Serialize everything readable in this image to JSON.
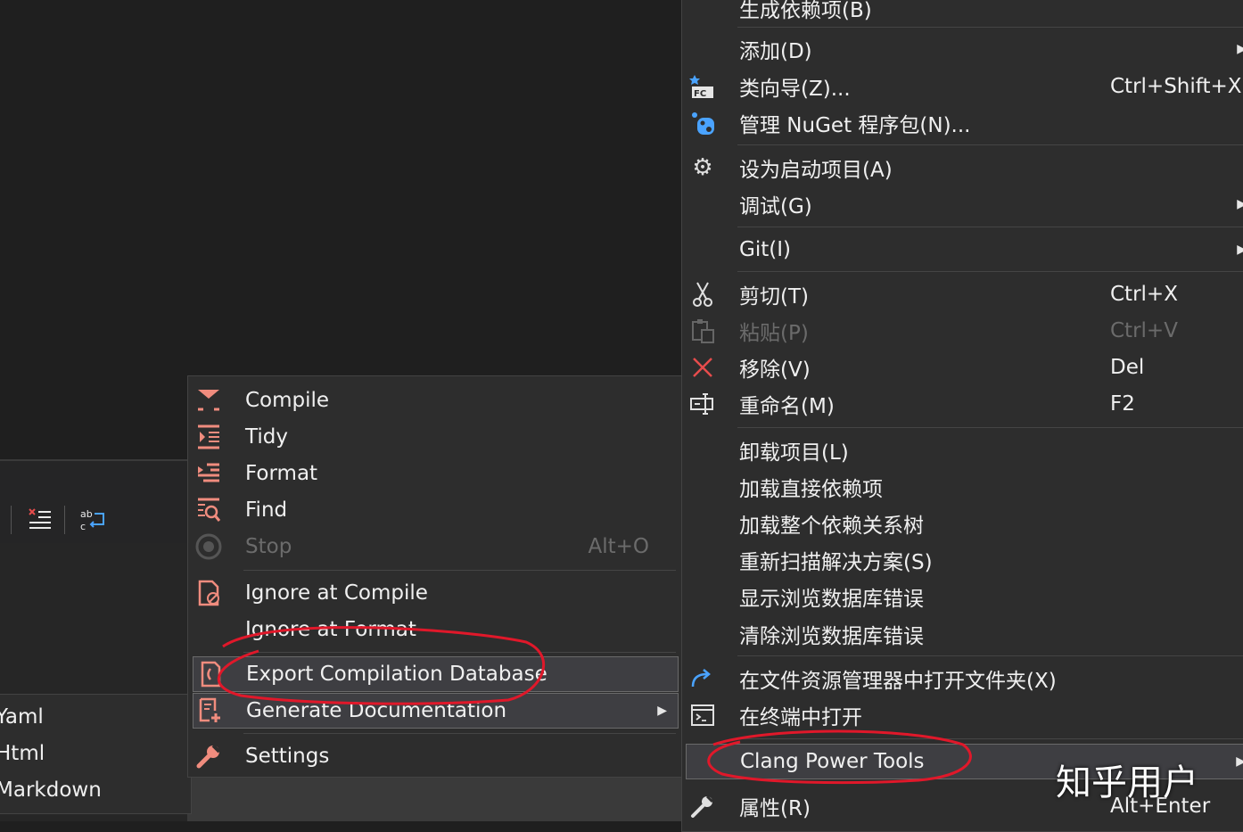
{
  "context_menu": {
    "items": [
      {
        "label": "生成依赖项(B)",
        "icon": "none"
      },
      {
        "label": "添加(D)",
        "icon": "none",
        "submenu": true
      },
      {
        "label": "类向导(Z)...",
        "icon": "class-wizard-icon",
        "shortcut": "Ctrl+Shift+X"
      },
      {
        "label": "管理 NuGet 程序包(N)...",
        "icon": "nuget-icon"
      },
      {
        "label": "设为启动项目(A)",
        "icon": "gear-icon"
      },
      {
        "label": "调试(G)",
        "icon": "none",
        "submenu": true
      },
      {
        "label": "Git(I)",
        "icon": "none",
        "submenu": true
      },
      {
        "label": "剪切(T)",
        "icon": "scissors-icon",
        "shortcut": "Ctrl+X"
      },
      {
        "label": "粘贴(P)",
        "icon": "paste-icon",
        "shortcut": "Ctrl+V",
        "disabled": true
      },
      {
        "label": "移除(V)",
        "icon": "remove-icon",
        "shortcut": "Del"
      },
      {
        "label": "重命名(M)",
        "icon": "rename-icon",
        "shortcut": "F2"
      },
      {
        "label": "卸载项目(L)",
        "icon": "none"
      },
      {
        "label": "加载直接依赖项",
        "icon": "none"
      },
      {
        "label": "加载整个依赖关系树",
        "icon": "none"
      },
      {
        "label": "重新扫描解决方案(S)",
        "icon": "none"
      },
      {
        "label": "显示浏览数据库错误",
        "icon": "none"
      },
      {
        "label": "清除浏览数据库错误",
        "icon": "none"
      },
      {
        "label": "在文件资源管理器中打开文件夹(X)",
        "icon": "open-folder-arrow-icon"
      },
      {
        "label": "在终端中打开",
        "icon": "terminal-icon"
      },
      {
        "label": "Clang Power Tools",
        "icon": "none",
        "submenu": true,
        "highlighted": true
      },
      {
        "label": "属性(R)",
        "icon": "wrench-icon",
        "shortcut": "Alt+Enter"
      }
    ]
  },
  "clang_submenu": {
    "items": [
      {
        "label": "Compile",
        "icon": "compile-icon"
      },
      {
        "label": "Tidy",
        "icon": "tidy-icon"
      },
      {
        "label": "Format",
        "icon": "format-icon"
      },
      {
        "label": "Find",
        "icon": "find-icon"
      },
      {
        "label": "Stop",
        "icon": "stop-icon",
        "shortcut": "Alt+O",
        "disabled": true
      },
      {
        "label": "Ignore at Compile",
        "icon": "ignore-compile-icon"
      },
      {
        "label": "Ignore at Format",
        "icon": "none"
      },
      {
        "label": "Export Compilation Database",
        "icon": "export-db-icon",
        "highlighted": true
      },
      {
        "label": "Generate Documentation",
        "icon": "generate-doc-icon",
        "submenu": true
      },
      {
        "label": "Settings",
        "icon": "wrench-icon"
      }
    ]
  },
  "doc_submenu": {
    "items": [
      {
        "label": "Yaml"
      },
      {
        "label": "Html"
      },
      {
        "label": "Markdown"
      }
    ]
  },
  "watermark": "知乎用户",
  "colors": {
    "menu_bg": "#2d2d2d",
    "highlight": "#3e3e42",
    "annotation_red": "#e0182a",
    "icon_salmon": "#f08c7e",
    "icon_blue": "#4aa3ff"
  }
}
